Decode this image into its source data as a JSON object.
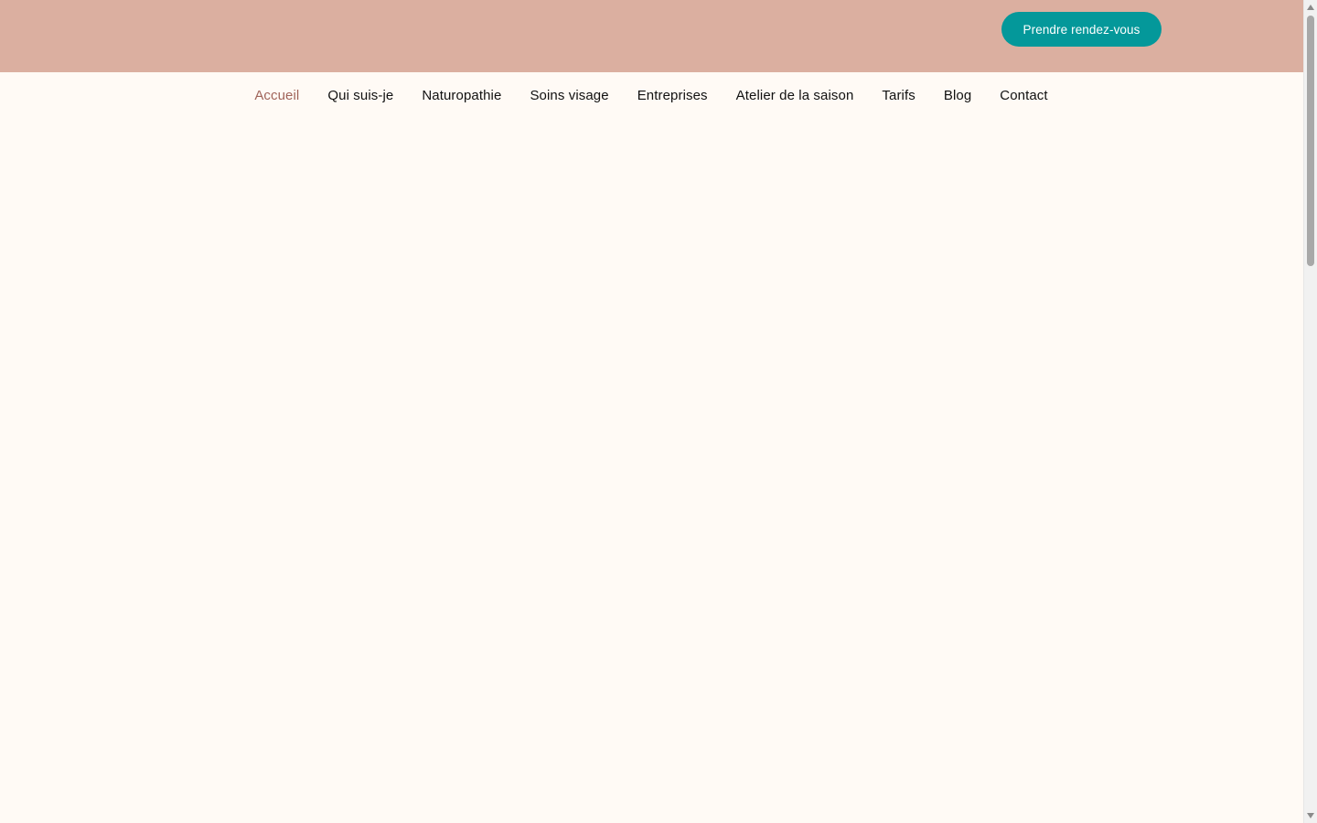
{
  "header": {
    "cta_label": "Prendre rendez-vous"
  },
  "nav": {
    "items": [
      {
        "label": "Accueil",
        "active": true
      },
      {
        "label": "Qui suis-je",
        "active": false
      },
      {
        "label": "Naturopathie",
        "active": false
      },
      {
        "label": "Soins visage",
        "active": false
      },
      {
        "label": "Entreprises",
        "active": false
      },
      {
        "label": "Atelier de la saison",
        "active": false
      },
      {
        "label": "Tarifs",
        "active": false
      },
      {
        "label": "Blog",
        "active": false
      },
      {
        "label": "Contact",
        "active": false
      }
    ]
  },
  "colors": {
    "topbar_bg": "#dbafa0",
    "page_bg": "#fffaf5",
    "cta_bg": "#04989a",
    "nav_active": "#a0645a",
    "nav_text": "#111111"
  },
  "scrollbar": {
    "position_fraction": 0.0
  }
}
